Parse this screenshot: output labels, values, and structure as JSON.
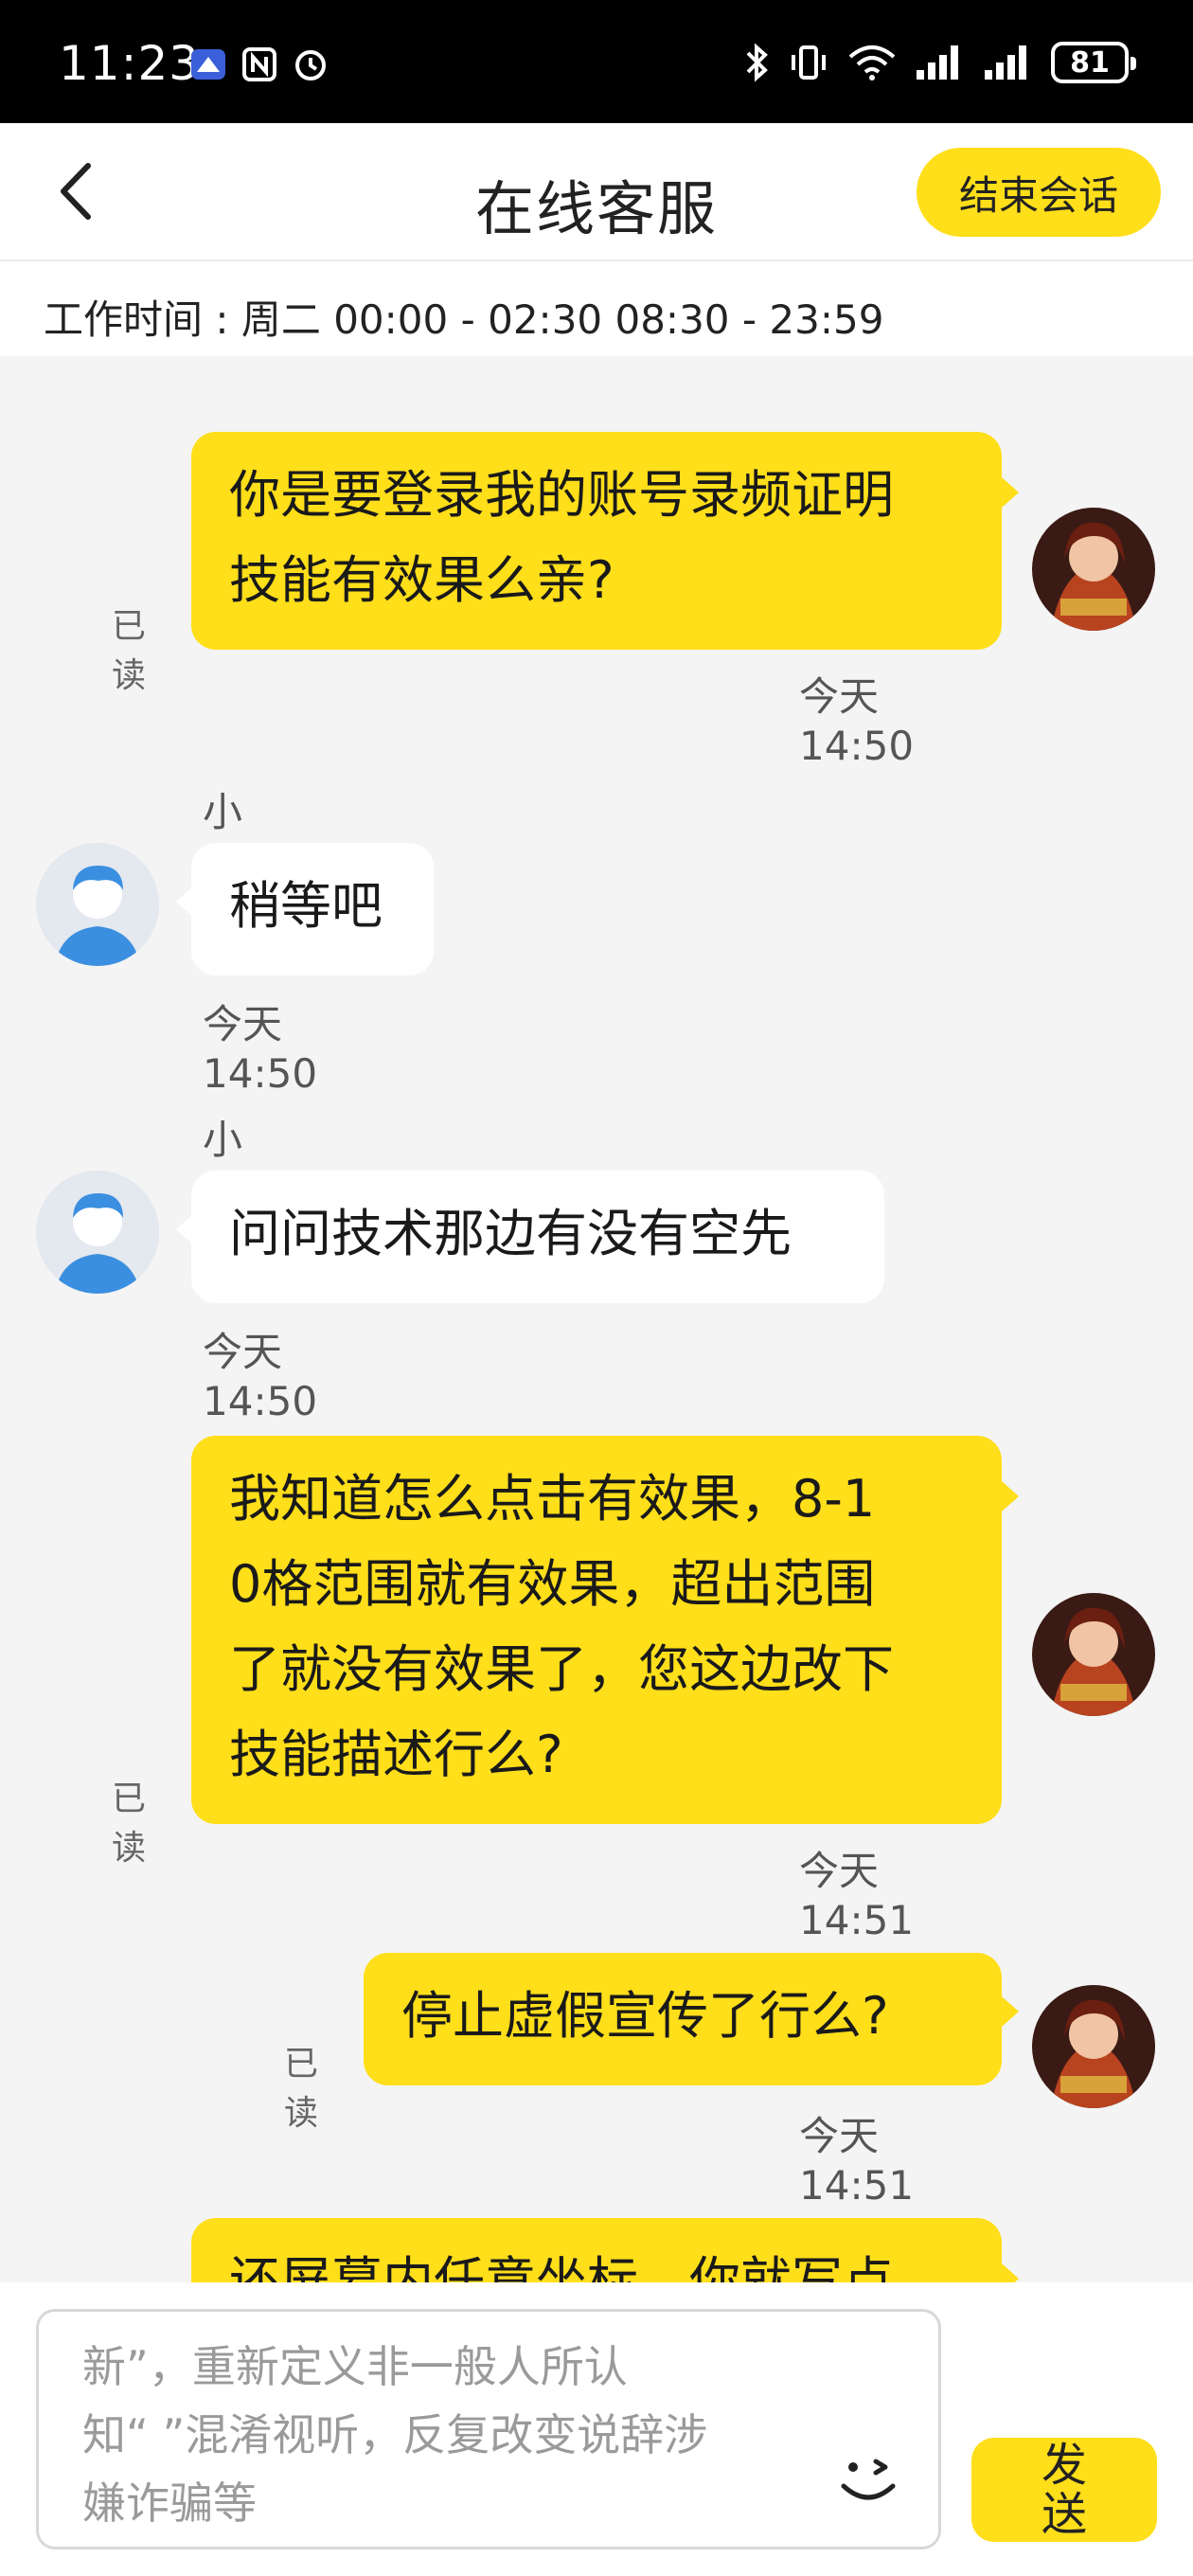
{
  "status_bar": {
    "time": "11:23",
    "battery": "81"
  },
  "header": {
    "title": "在线客服",
    "end_button": "结束会话"
  },
  "work_hours": "工作时间 : 周二 00:00 - 02:30 08:30 - 23:59",
  "messages": [
    {
      "side": "out",
      "lines": [
        "你是要登录我的账号录频证明",
        "技能有效果么亲?"
      ],
      "read": "已读",
      "time": "今天 14:50"
    },
    {
      "side": "in",
      "sender": "小萱",
      "lines": [
        "稍等吧"
      ],
      "time": "今天 14:50"
    },
    {
      "side": "in",
      "sender": "小萱",
      "lines": [
        "问问技术那边有没有空先"
      ],
      "time": "今天 14:50"
    },
    {
      "side": "out",
      "lines": [
        "我知道怎么点击有效果，8-1",
        "0格范围就有效果，超出范围",
        "了就没有效果了，您这边改下",
        "技能描述行么?"
      ],
      "read": "已读",
      "time": "今天 14:51"
    },
    {
      "side": "out",
      "lines": [
        "停止虚假宣传了行么?"
      ],
      "read": "已读",
      "time": "今天 14:51"
    },
    {
      "side": "out",
      "lines": [
        "还屏幕内任意坐标，你就写点"
      ]
    }
  ],
  "input": {
    "text_lines": [
      "新”，重新定义非一般人所认",
      "知“ ”混淆视听，反复改变说辞涉",
      "嫌诈骗等"
    ],
    "send_lines": [
      "发",
      "送"
    ]
  },
  "colors": {
    "accent": "#ffde1a",
    "background": "#f4f4f4"
  },
  "icons": [
    "back-arrow-icon",
    "emoji-icon",
    "nfc-icon",
    "bluetooth-icon",
    "wifi-icon",
    "signal-icon"
  ]
}
